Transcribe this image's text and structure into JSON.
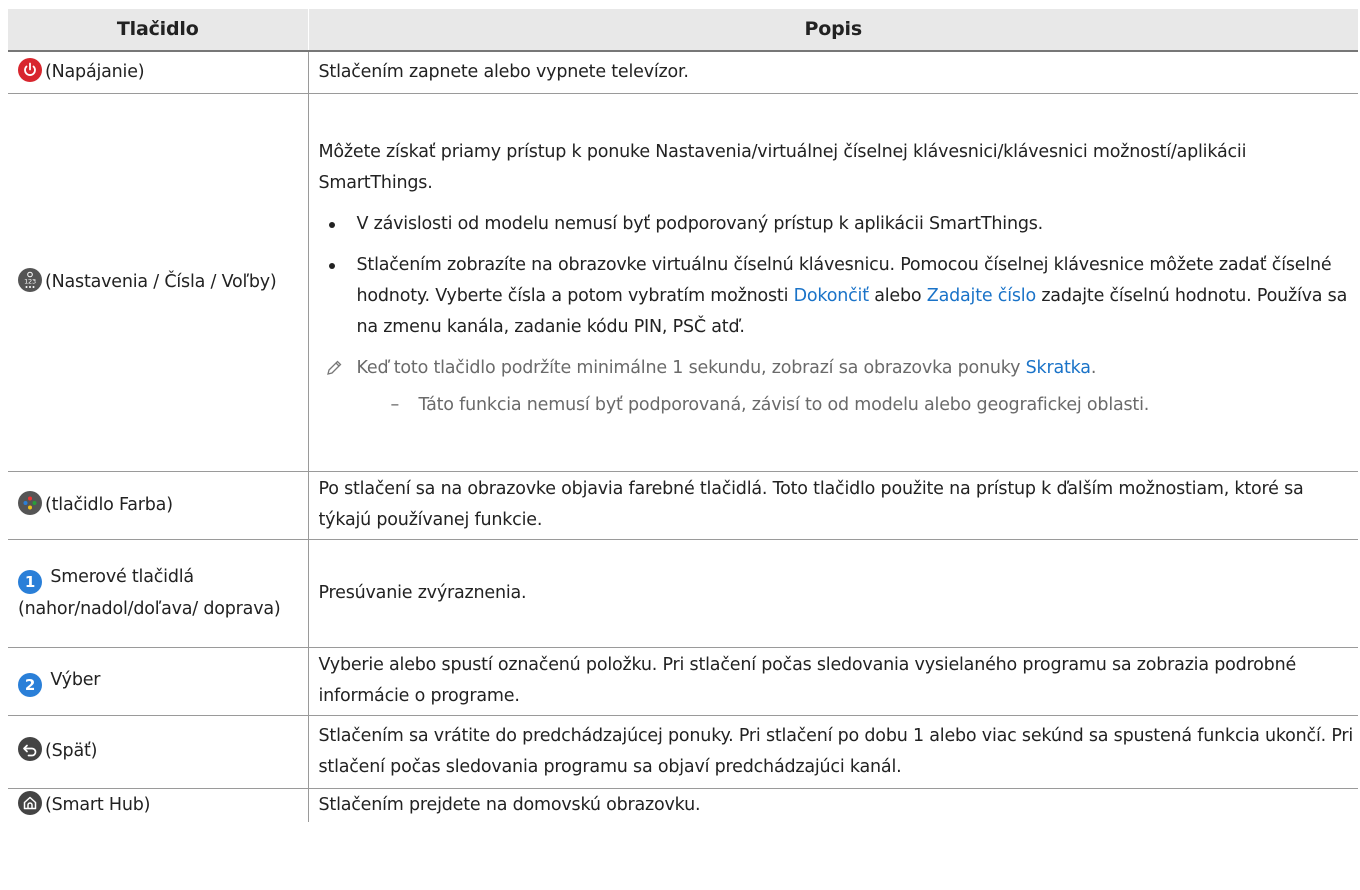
{
  "header": {
    "col_button": "Tlačidlo",
    "col_description": "Popis"
  },
  "rows": [
    {
      "button": "(Napájanie)",
      "desc": "Stlačením zapnete alebo vypnete televízor."
    },
    {
      "button": "(Nastavenia / Čísla / Voľby)",
      "desc_intro": "Môžete získať priamy prístup k ponuke Nastavenia/virtuálnej číselnej klávesnici/klávesnici možností/aplikácii SmartThings.",
      "bullet1": "V závislosti od modelu nemusí byť podporovaný prístup k aplikácii SmartThings.",
      "bullet2_a": "Stlačením zobrazíte na obrazovke virtuálnu číselnú klávesnicu. Pomocou číselnej klávesnice môžete zadať číselné hodnoty. Vyberte čísla a potom vybratím možnosti ",
      "bullet2_link1": "Dokončiť",
      "bullet2_b": " alebo ",
      "bullet2_link2": "Zadajte číslo",
      "bullet2_c": " zadajte číselnú hodnotu. Používa sa na zmenu kanála, zadanie kódu PIN, PSČ atď.",
      "note_a": "Keď toto tlačidlo podržíte minimálne 1 sekundu, zobrazí sa obrazovka ponuky ",
      "note_link": "Skratka",
      "note_b": ".",
      "subnote_dash": "–",
      "subnote": "Táto funkcia nemusí byť podporovaná, závisí to od modelu alebo geografickej oblasti."
    },
    {
      "button": "(tlačidlo Farba)",
      "desc": "Po stlačení sa na obrazovke objavia farebné tlačidlá. Toto tlačidlo použite na prístup k ďalším možnostiam, ktoré sa týkajú používanej funkcie."
    },
    {
      "badge": "1",
      "button": "Smerové tlačidlá (nahor/nadol/doľava/ doprava)",
      "desc": "Presúvanie zvýraznenia."
    },
    {
      "badge": "2",
      "button": "Výber",
      "desc": "Vyberie alebo spustí označenú položku. Pri stlačení počas sledovania vysielaného programu sa zobrazia podrobné informácie o programe."
    },
    {
      "button": "(Späť)",
      "desc": "Stlačením sa vrátite do predchádzajúcej ponuky. Pri stlačení po dobu 1 alebo viac sekúnd sa spustená funkcia ukončí. Pri stlačení počas sledovania programu sa objaví predchádzajúci kanál."
    },
    {
      "button": "(Smart Hub)",
      "desc": "Stlačením prejdete na domovskú obrazovku."
    }
  ],
  "colors": {
    "header_bg": "#e8e8e8",
    "link": "#1a73c8",
    "power": "#d8262e",
    "badge": "#2a7fd8",
    "note_text": "#6a6a6a"
  },
  "icons": [
    "power-icon",
    "settings-numbers-icon",
    "color-button-icon",
    "badge-1",
    "badge-2",
    "back-icon",
    "home-icon",
    "pencil-icon"
  ]
}
